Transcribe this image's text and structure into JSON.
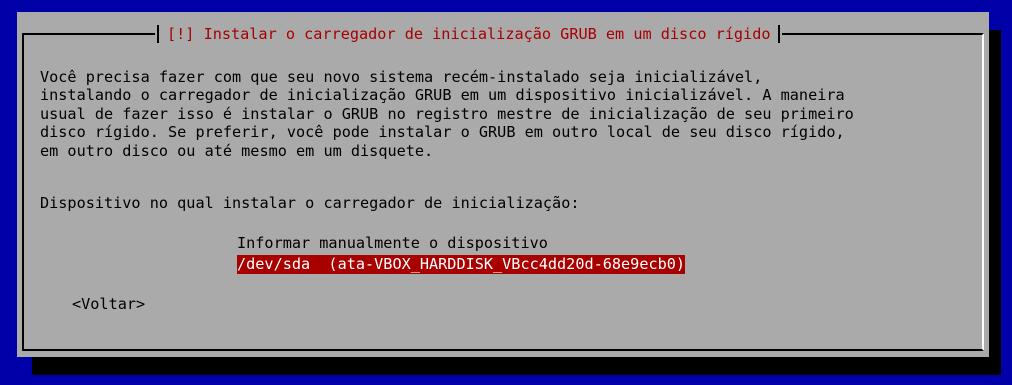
{
  "dialog": {
    "title": "[!] Instalar o carregador de inicialização GRUB em um disco rígido",
    "body_lines": [
      "Você precisa fazer com que seu novo sistema recém-instalado seja inicializável,",
      "instalando o carregador de inicialização GRUB em um dispositivo inicializável. A maneira",
      "usual de fazer isso é instalar o GRUB no registro mestre de inicialização de seu primeiro",
      "disco rígido. Se preferir, você pode instalar o GRUB em outro local de seu disco rígido,",
      "em outro disco ou até mesmo em um disquete."
    ],
    "prompt": "Dispositivo no qual instalar o carregador de inicialização:",
    "options": [
      "Informar manualmente o dispositivo",
      "/dev/sda  (ata-VBOX_HARDDISK_VBcc4dd20d-68e9ecb0)"
    ],
    "selected_index": 1,
    "back_button": "<Voltar>"
  },
  "colors": {
    "screen_background": "#0000a8",
    "dialog_background": "#aaaaaa",
    "title_text": "#a80000",
    "selection_background": "#a80000",
    "selection_text": "#ffffff"
  }
}
